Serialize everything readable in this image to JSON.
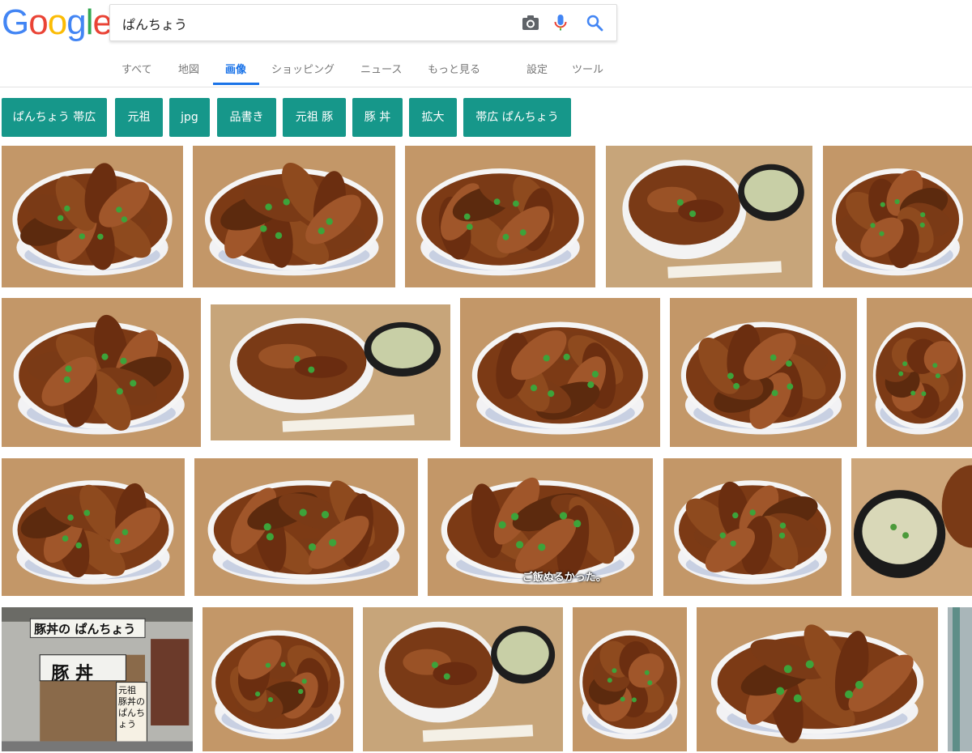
{
  "logo": {
    "letters": [
      "G",
      "o",
      "o",
      "g",
      "l",
      "e"
    ],
    "colors": [
      "#4285f4",
      "#ea4335",
      "#fbbc05",
      "#4285f4",
      "#34a853",
      "#ea4335"
    ]
  },
  "search": {
    "query": "ぱんちょう"
  },
  "icons": {
    "camera": "camera-icon",
    "mic": "mic-icon",
    "search": "search-icon"
  },
  "tabs": [
    {
      "label": "すべて",
      "active": false
    },
    {
      "label": "地図",
      "active": false
    },
    {
      "label": "画像",
      "active": true
    },
    {
      "label": "ショッピング",
      "active": false
    },
    {
      "label": "ニュース",
      "active": false
    },
    {
      "label": "もっと見る",
      "active": false
    },
    {
      "label": "設定",
      "active": false
    },
    {
      "label": "ツール",
      "active": false
    }
  ],
  "chips": [
    {
      "label": "ぱんちょう 帯広"
    },
    {
      "label": "元祖"
    },
    {
      "label": "jpg"
    },
    {
      "label": "品書き"
    },
    {
      "label": "元祖 豚"
    },
    {
      "label": "豚 丼"
    },
    {
      "label": "拡大"
    },
    {
      "label": "帯広 ぱんちょう"
    }
  ],
  "accent_color": "#1a73e8",
  "chip_color": "#16978a",
  "results": [
    {
      "kind": "bowl"
    },
    {
      "kind": "bowl"
    },
    {
      "kind": "bowl"
    },
    {
      "kind": "tray"
    },
    {
      "kind": "bowl"
    },
    {
      "kind": "bowl"
    },
    {
      "kind": "tray"
    },
    {
      "kind": "bowl"
    },
    {
      "kind": "bowl"
    },
    {
      "kind": "bowl"
    },
    {
      "kind": "bowl"
    },
    {
      "kind": "bowl"
    },
    {
      "kind": "bowl",
      "caption": "ご飯ぬるかった。"
    },
    {
      "kind": "bowl"
    },
    {
      "kind": "soup"
    },
    {
      "kind": "storefront",
      "sign_top": "豚丼の ぱんちょう",
      "sign_mid": "豚 丼",
      "sign_side": "元祖 豚丼の ぱんちょう"
    },
    {
      "kind": "bowl"
    },
    {
      "kind": "tray"
    },
    {
      "kind": "bowl"
    },
    {
      "kind": "bowl"
    },
    {
      "kind": "street"
    }
  ]
}
